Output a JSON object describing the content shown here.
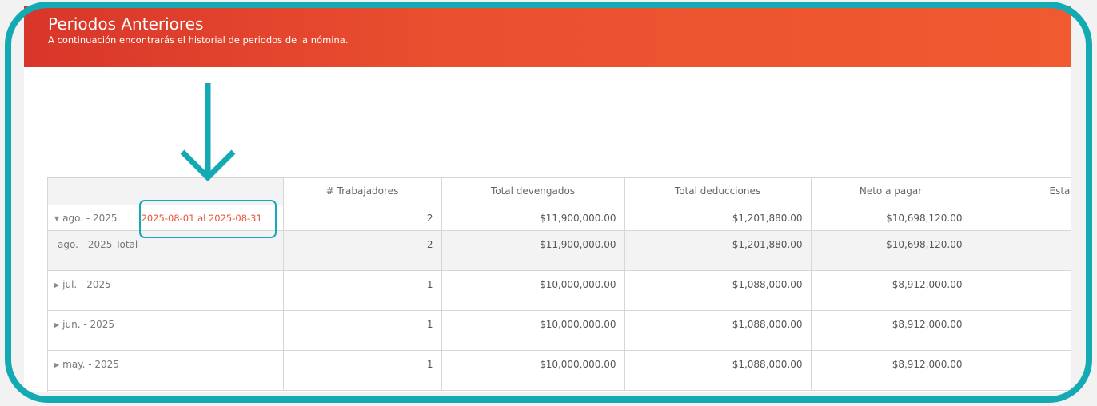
{
  "header": {
    "title": "Periodos Anteriores",
    "subtitle": "A continuación encontrarás el historial de periodos de la nómina."
  },
  "table": {
    "columns": [
      "",
      "# Trabajadores",
      "Total devengados",
      "Total deducciones",
      "Neto a pagar",
      "Esta"
    ],
    "expanded_row": {
      "label": "ago. - 2025",
      "range": "2025-08-01 al 2025-08-31",
      "values": [
        "2",
        "$11,900,000.00",
        "$1,201,880.00",
        "$10,698,120.00",
        ""
      ]
    },
    "total_row": {
      "label": "ago. - 2025 Total",
      "values": [
        "2",
        "$11,900,000.00",
        "$1,201,880.00",
        "$10,698,120.00",
        ""
      ]
    },
    "rows": [
      {
        "label": "jul. - 2025",
        "values": [
          "1",
          "$10,000,000.00",
          "$1,088,000.00",
          "$8,912,000.00",
          ""
        ]
      },
      {
        "label": "jun. - 2025",
        "values": [
          "1",
          "$10,000,000.00",
          "$1,088,000.00",
          "$8,912,000.00",
          ""
        ]
      },
      {
        "label": "may. - 2025",
        "values": [
          "1",
          "$10,000,000.00",
          "$1,088,000.00",
          "$8,912,000.00",
          ""
        ]
      }
    ]
  },
  "colors": {
    "header_gradient": [
      "#d8362a",
      "#f05a30"
    ],
    "annotation": "#14aab4",
    "range_text": "#e8543a"
  },
  "icons": {
    "expanded": "caret-down-icon",
    "collapsed": "caret-right-icon"
  }
}
